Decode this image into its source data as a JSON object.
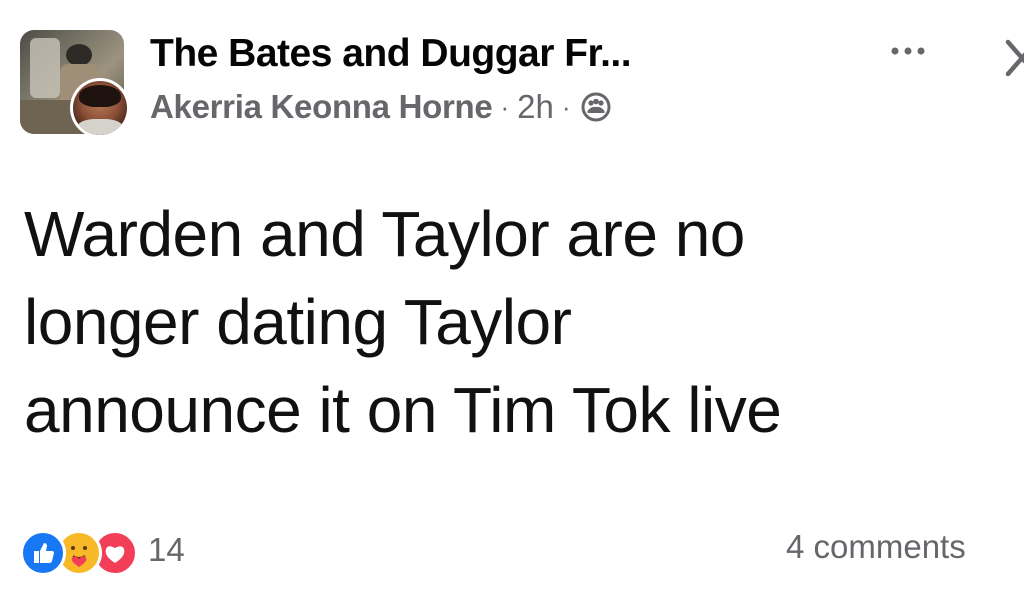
{
  "post": {
    "group_name": "The Bates and Duggar Fr...",
    "author": "Akerria Keonna Horne",
    "separator": "·",
    "time": "2h",
    "audience_icon": "group-audience-icon",
    "more_icon": "more-options-icon",
    "close_icon": "close-icon",
    "text_lines": [
      "Warden and Taylor are no",
      "longer dating Taylor",
      "announce it on Tim Tok live"
    ]
  },
  "footer": {
    "reaction_icons": [
      "like-icon",
      "care-icon",
      "love-icon"
    ],
    "reaction_count": "14",
    "comments_label": "4 comments"
  },
  "colors": {
    "secondary_text": "#65676b",
    "like": "#1877f2",
    "care": "#f7b928",
    "love": "#f33e58"
  }
}
